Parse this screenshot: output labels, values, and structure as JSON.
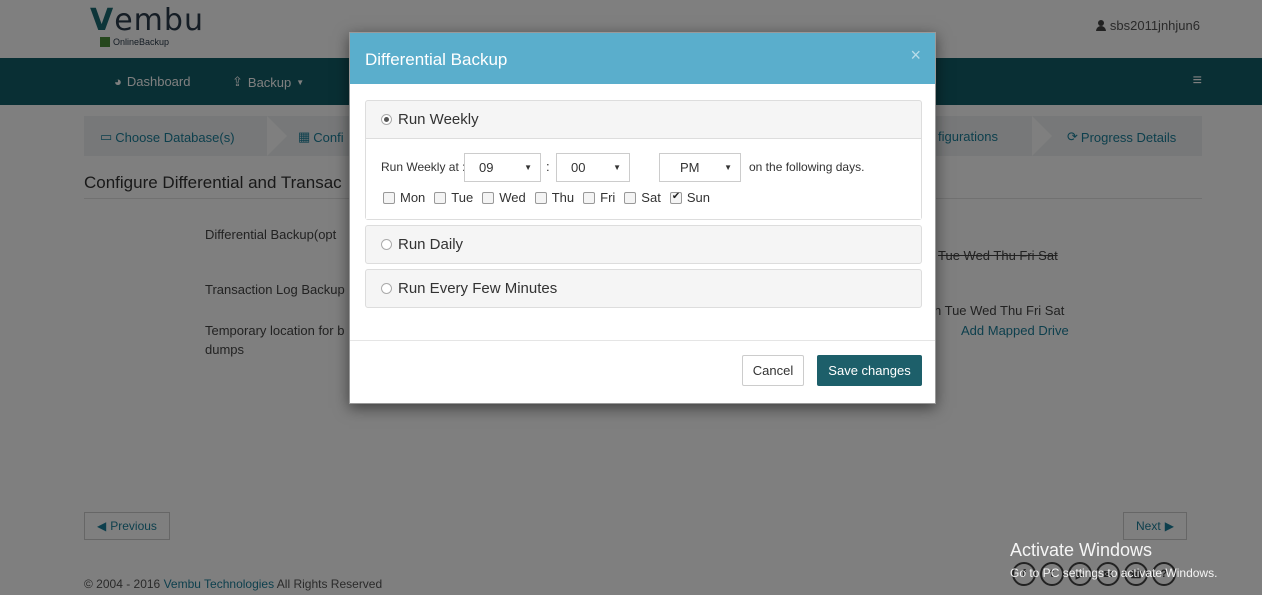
{
  "brand": {
    "name": "Vembu",
    "first_letter": "V",
    "rest": "embu",
    "sub": "OnlineBackup",
    "accent": "#125f68"
  },
  "user": {
    "name": "sbs2011jnhjun6"
  },
  "nav": {
    "items": [
      {
        "label": "Dashboard",
        "icon": "pie-chart-icon"
      },
      {
        "label": "Backup",
        "icon": "upload-icon"
      }
    ],
    "menu_icon": "hamburger-icon"
  },
  "wizard": {
    "steps": [
      {
        "label": "Choose Database(s)",
        "icon": "monitor-icon"
      },
      {
        "label": "Confi",
        "icon": "calendar-icon"
      },
      {
        "label": "figurations"
      },
      {
        "label": "Progress Details",
        "icon": "refresh-icon"
      }
    ]
  },
  "page": {
    "title": "Configure Differential and Transac",
    "rows": [
      {
        "label": "Differential Backup(opt",
        "value": "Tue Wed Thu Fri Sat"
      },
      {
        "label": "Transaction Log Backup",
        "value": "n Tue Wed Thu Fri Sat"
      },
      {
        "label": "Temporary location for b",
        "label2": "dumps",
        "link": "Add Mapped Drive"
      }
    ],
    "prev_label": "Previous",
    "next_label": "Next"
  },
  "footer": {
    "copyright_pre": "© 2004 - 2016",
    "company": "Vembu Technologies",
    "copyright_post": "All Rights Reserved",
    "social_icons": [
      "facebook-icon",
      "twitter-icon",
      "youtube-icon",
      "email-icon",
      "phone-icon",
      "help-icon"
    ]
  },
  "watermark": {
    "line1": "Activate Windows",
    "line2": "Go to PC settings to activate Windows."
  },
  "modal": {
    "title": "Differential Backup",
    "close": "×",
    "options": [
      {
        "label": "Run Weekly",
        "selected": true
      },
      {
        "label": "Run Daily",
        "selected": false
      },
      {
        "label": "Run Every Few Minutes",
        "selected": false
      }
    ],
    "weekly": {
      "run_at_label": "Run Weekly at :",
      "hour": "09",
      "separator": ":",
      "minute": "00",
      "ampm": "PM",
      "suffix": "on the following days.",
      "days": [
        {
          "label": "Mon",
          "checked": false
        },
        {
          "label": "Tue",
          "checked": false
        },
        {
          "label": "Wed",
          "checked": false
        },
        {
          "label": "Thu",
          "checked": false
        },
        {
          "label": "Fri",
          "checked": false
        },
        {
          "label": "Sat",
          "checked": false
        },
        {
          "label": "Sun",
          "checked": true
        }
      ]
    },
    "cancel_label": "Cancel",
    "save_label": "Save changes"
  }
}
